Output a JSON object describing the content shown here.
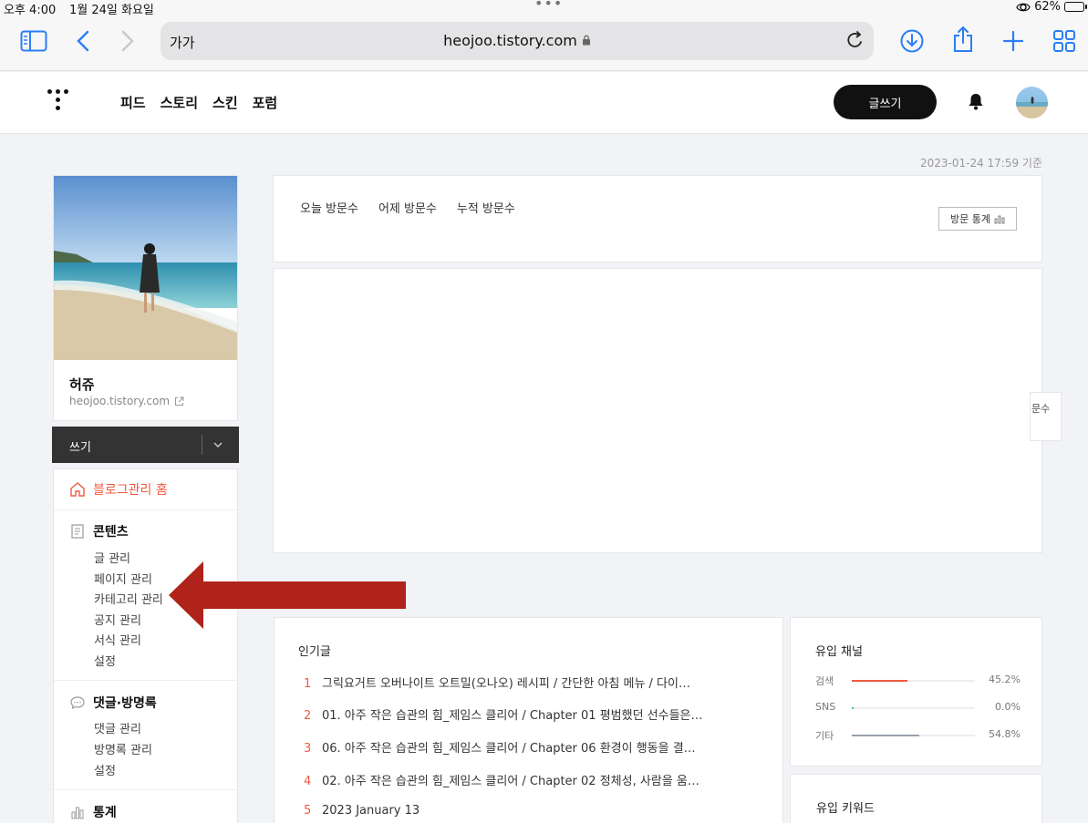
{
  "status_bar": {
    "time": "오후 4:00",
    "date": "1월 24일 화요일",
    "battery": "62%",
    "battery_level": 0.62
  },
  "browser": {
    "aa_label": "가가",
    "url": "heojoo.tistory.com"
  },
  "nav": {
    "links": [
      "피드",
      "스토리",
      "스킨",
      "포럼"
    ],
    "write_button": "글쓰기"
  },
  "timestamp": "2023-01-24 17:59 기준",
  "profile": {
    "name": "허쥬",
    "url": "heojoo.tistory.com"
  },
  "sidebar": {
    "write_label": "쓰기",
    "home": "블로그관리 홈",
    "contents": {
      "title": "콘텐츠",
      "items": [
        "글 관리",
        "페이지 관리",
        "카테고리 관리",
        "공지 관리",
        "서식 관리",
        "설정"
      ]
    },
    "comments": {
      "title": "댓글·방명록",
      "items": [
        "댓글 관리",
        "방명록 관리",
        "설정"
      ]
    },
    "stats": {
      "title": "통계"
    }
  },
  "visits": {
    "tabs": [
      "오늘 방문수",
      "어제 방문수",
      "누적 방문수"
    ],
    "stat_button": "방문 통계"
  },
  "side_tab": "문수",
  "popular": {
    "title": "인기글",
    "items": [
      {
        "rank": "1",
        "title": "그릭요거트 오버나이트 오트밀(오나오) 레시피 / 간단한 아침 메뉴 / 다이…"
      },
      {
        "rank": "2",
        "title": "01. 아주 작은 습관의 힘_제임스 클리어 / Chapter 01 평범했던 선수들은…"
      },
      {
        "rank": "3",
        "title": "06. 아주 작은 습관의 힘_제임스 클리어 / Chapter 06 환경이 행동을 결…"
      },
      {
        "rank": "4",
        "title": "02. 아주 작은 습관의 힘_제임스 클리어 / Chapter 02 정체성, 사람을 움…"
      },
      {
        "rank": "5",
        "title": "2023 January 13"
      }
    ]
  },
  "inflow": {
    "title": "유입 채널",
    "rows": [
      {
        "label": "검색",
        "percent": "45.2%",
        "value": 45.2,
        "color": "#ef5a42"
      },
      {
        "label": "SNS",
        "percent": "0.0%",
        "value": 0.0,
        "color": "#3fc1a5"
      },
      {
        "label": "기타",
        "percent": "54.8%",
        "value": 54.8,
        "color": "#9aa1ad"
      }
    ]
  },
  "keyword": {
    "title": "유입 키워드"
  },
  "colors": {
    "accent": "#ef5a42",
    "arrow": "#b0231a",
    "safari_blue": "#2a7ef5"
  }
}
